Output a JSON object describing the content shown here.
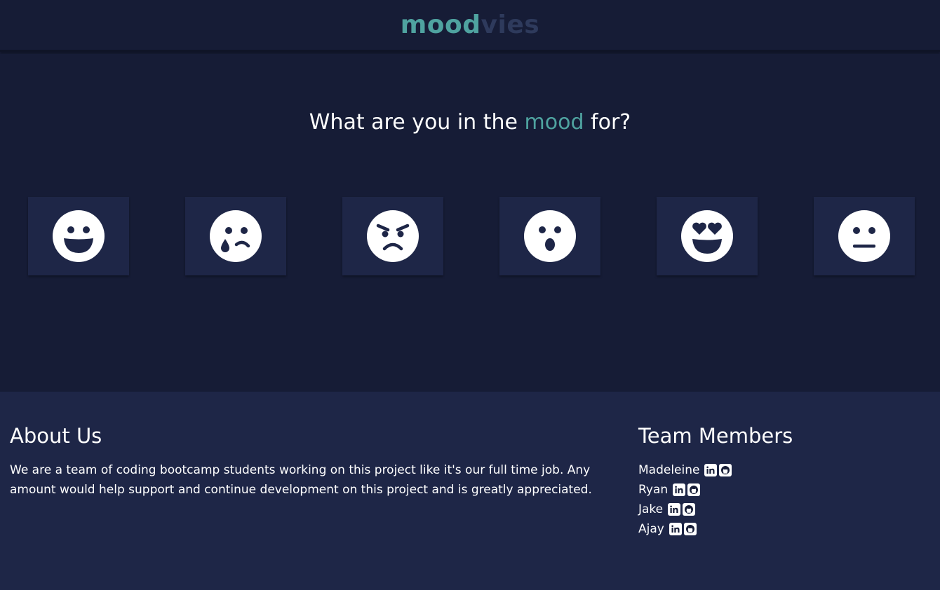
{
  "header": {
    "logo_part1": "mood",
    "logo_part2": "vies",
    "logo_color1": "#4fa3a0",
    "logo_color2": "#2e3a5c"
  },
  "hero": {
    "question_before": "What are you in the ",
    "question_highlight": "mood",
    "question_after": " for?",
    "moods": [
      {
        "icon": "grinning-face-icon"
      },
      {
        "icon": "crying-face-icon"
      },
      {
        "icon": "angry-face-icon"
      },
      {
        "icon": "surprised-face-icon"
      },
      {
        "icon": "heart-eyes-face-icon"
      },
      {
        "icon": "neutral-face-icon"
      }
    ]
  },
  "footer": {
    "about_title": "About Us",
    "about_text": "We are a team of coding bootcamp students working on this project like it's our full time job. Any amount would help support and continue development on this project and is greatly appreciated.",
    "team_title": "Team Members",
    "members": [
      {
        "name": "Madeleine",
        "icons": [
          "linkedin-icon",
          "github-icon"
        ]
      },
      {
        "name": "Ryan",
        "icons": [
          "linkedin-icon",
          "github-icon"
        ]
      },
      {
        "name": "Jake",
        "icons": [
          "linkedin-icon",
          "github-icon"
        ]
      },
      {
        "name": "Ajay",
        "icons": [
          "linkedin-icon",
          "github-icon"
        ]
      }
    ]
  },
  "colors": {
    "background": "#161c36",
    "panel": "#1e2647",
    "accent": "#4fa3a0",
    "text": "#ffffff"
  }
}
